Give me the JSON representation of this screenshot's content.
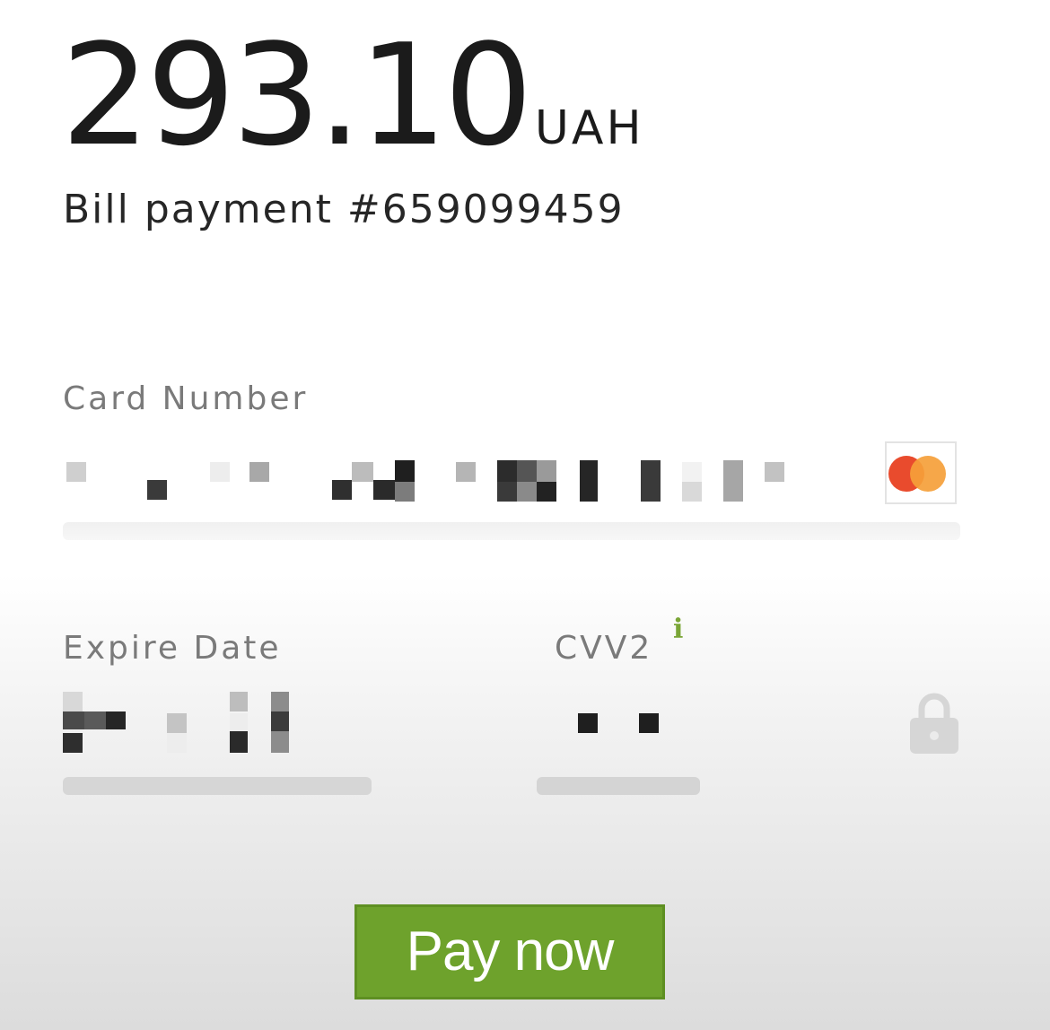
{
  "payment": {
    "amount": "293.10",
    "currency": "UAH",
    "description": "Bill payment #659099459"
  },
  "form": {
    "card_number_label": "Card Number",
    "expire_date_label": "Expire Date",
    "cvv_label": "CVV2",
    "cvv_info_glyph": "i",
    "card_brand_icon": "mastercard-icon",
    "lock_icon": "lock-icon"
  },
  "actions": {
    "pay_label": "Pay now"
  },
  "colors": {
    "pay_button": "#6ea22c",
    "info_icon": "#7aa536",
    "mastercard_red": "#e94b2d",
    "mastercard_orange": "#f5a03a"
  }
}
